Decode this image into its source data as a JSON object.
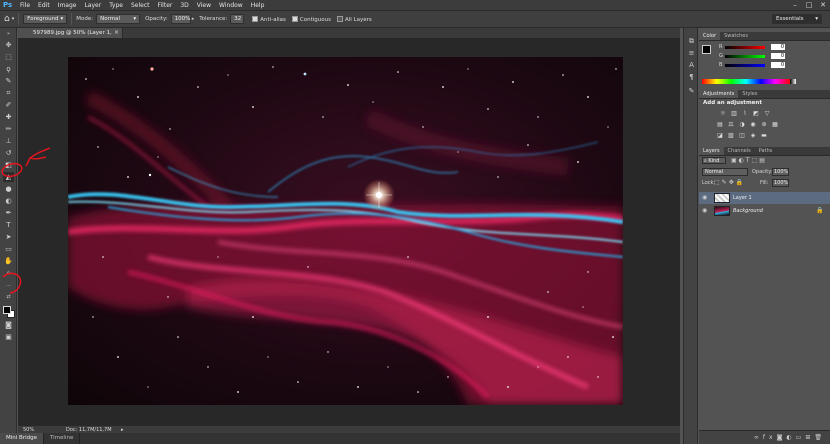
{
  "app": {
    "logo": "Ps"
  },
  "menu": [
    "File",
    "Edit",
    "Image",
    "Layer",
    "Type",
    "Select",
    "Filter",
    "3D",
    "View",
    "Window",
    "Help"
  ],
  "window_controls": [
    "–",
    "□",
    "✕"
  ],
  "options": {
    "fill_source": "Foreground",
    "mode_label": "Mode:",
    "mode_value": "Normal",
    "opacity_label": "Opacity:",
    "opacity_value": "100%",
    "tolerance_label": "Tolerance:",
    "tolerance_value": "32",
    "anti_alias": "Anti-alias",
    "contiguous": "Contiguous",
    "all_layers": "All Layers",
    "workspace": "Essentials"
  },
  "document": {
    "tab_title": "597989.jpg @ 50% (Layer 1, RGB/8#) *",
    "close": "×"
  },
  "status": {
    "zoom": "50%",
    "doc_info": "Doc: 11,7M/11,7M"
  },
  "bottom_tabs": [
    "Mini Bridge",
    "Timeline"
  ],
  "color_panel": {
    "tabs": [
      "Color",
      "Swatches"
    ],
    "channels": [
      {
        "label": "R",
        "value": "0"
      },
      {
        "label": "G",
        "value": "0"
      },
      {
        "label": "B",
        "value": "0"
      }
    ]
  },
  "adjustments_panel": {
    "tabs": [
      "Adjustments",
      "Styles"
    ],
    "heading": "Add an adjustment"
  },
  "layers_panel": {
    "tabs": [
      "Layers",
      "Channels",
      "Paths"
    ],
    "filter_kind": "Kind",
    "blend_mode": "Normal",
    "opacity_label": "Opacity:",
    "opacity_value": "100%",
    "lock_label": "Lock:",
    "fill_label": "Fill:",
    "fill_value": "100%",
    "layers": [
      {
        "name": "Layer 1",
        "selected": true
      },
      {
        "name": "Background",
        "selected": false
      }
    ]
  },
  "colors": {
    "annotation_red": "#e8141e",
    "selected_layer": "#5d6b80",
    "accent_blue": "#4eb8ff"
  }
}
